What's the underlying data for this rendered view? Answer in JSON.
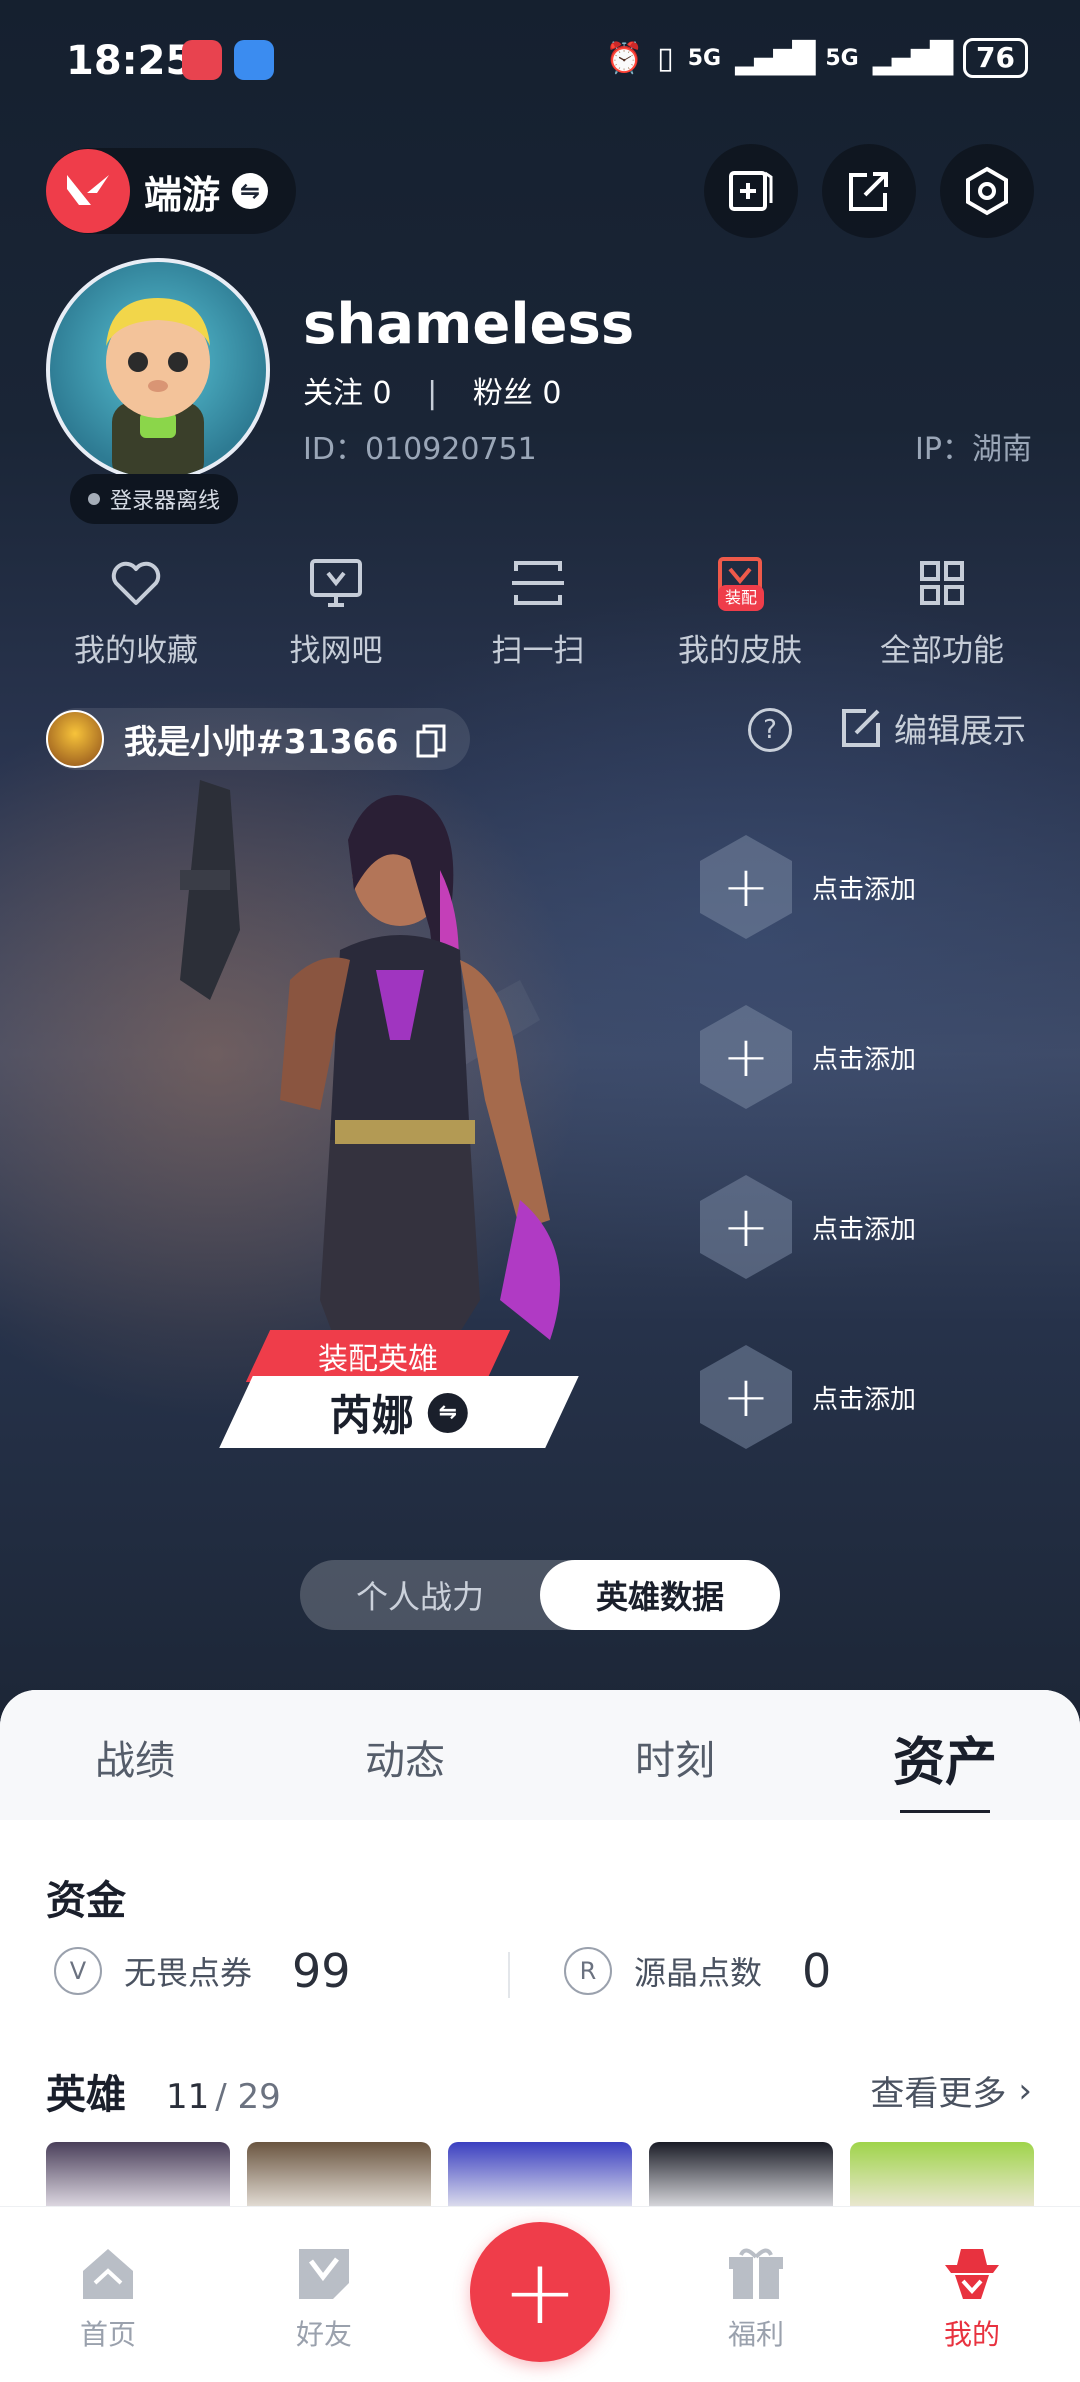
{
  "status_bar": {
    "time": "18:25",
    "signal1": "5G",
    "signal2": "5G",
    "battery": "76"
  },
  "header": {
    "app_switch_label": "端游"
  },
  "profile": {
    "username": "shameless",
    "follow_label": "关注 0",
    "separator": "|",
    "fans_label": "粉丝 0",
    "id_text": "ID：010920751",
    "ip_text": "IP：湖南",
    "login_status": "登录器离线"
  },
  "quick_actions": [
    {
      "label": "我的收藏",
      "icon": "heart-icon"
    },
    {
      "label": "找网吧",
      "icon": "monitor-icon"
    },
    {
      "label": "扫一扫",
      "icon": "scan-icon"
    },
    {
      "label": "我的皮肤",
      "icon": "skin-icon",
      "badge": "装配"
    },
    {
      "label": "全部功能",
      "icon": "grid-icon"
    }
  ],
  "game_account": {
    "name": "我是小帅#31366",
    "help": "?",
    "edit_label": "编辑展示"
  },
  "hero_showcase": {
    "equip_label": "装配英雄",
    "hero_name": "芮娜",
    "slots": [
      "点击添加",
      "点击添加",
      "点击添加",
      "点击添加"
    ]
  },
  "segment": {
    "options": [
      "个人战力",
      "英雄数据"
    ],
    "active": "英雄数据"
  },
  "tabs": {
    "items": [
      "战绩",
      "动态",
      "时刻",
      "资产"
    ],
    "active": "资产"
  },
  "assets": {
    "funds_title": "资金",
    "funds": [
      {
        "label": "无畏点券",
        "value": "99",
        "icon": "valorant-point-icon"
      },
      {
        "label": "源晶点数",
        "value": "0",
        "icon": "radianite-icon"
      }
    ],
    "heroes_title": "英雄",
    "heroes_owned": "11",
    "heroes_total": "/ 29",
    "see_more": "查看更多"
  },
  "bottom_nav": {
    "items": [
      "首页",
      "好友",
      "福利",
      "我的"
    ],
    "active": "我的"
  },
  "colors": {
    "accent": "#ef3d4a",
    "panel": "#ffffff",
    "dark_bg": "#1b2334"
  }
}
